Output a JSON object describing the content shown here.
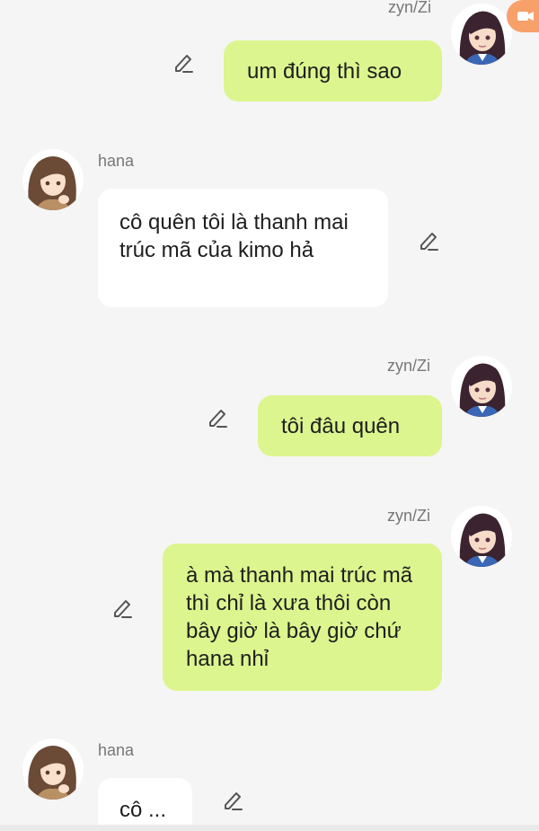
{
  "participants": {
    "me": "zyn/Zi",
    "other": "hana"
  },
  "messages": [
    {
      "sender": "zyn/Zi",
      "text": "um đúng thì sao"
    },
    {
      "sender": "hana",
      "text": "cô quên tôi là thanh mai trúc mã của kimo hả"
    },
    {
      "sender": "zyn/Zi",
      "text": "tôi đâu quên"
    },
    {
      "sender": "zyn/Zi",
      "text": "à mà thanh mai trúc mã thì chỉ là xưa thôi còn bây giờ là bây giờ chứ hana nhỉ"
    },
    {
      "sender": "hana",
      "text": "cô ..."
    }
  ],
  "colors": {
    "my_bubble": "#dcf58e",
    "their_bubble": "#ffffff",
    "background": "#f5f5f5",
    "accent_badge": "#f7a06a"
  },
  "icons": {
    "edit": "pencil-icon",
    "avatar_me": "avatar-zyn",
    "avatar_other": "avatar-hana",
    "top_badge": "video-icon"
  }
}
